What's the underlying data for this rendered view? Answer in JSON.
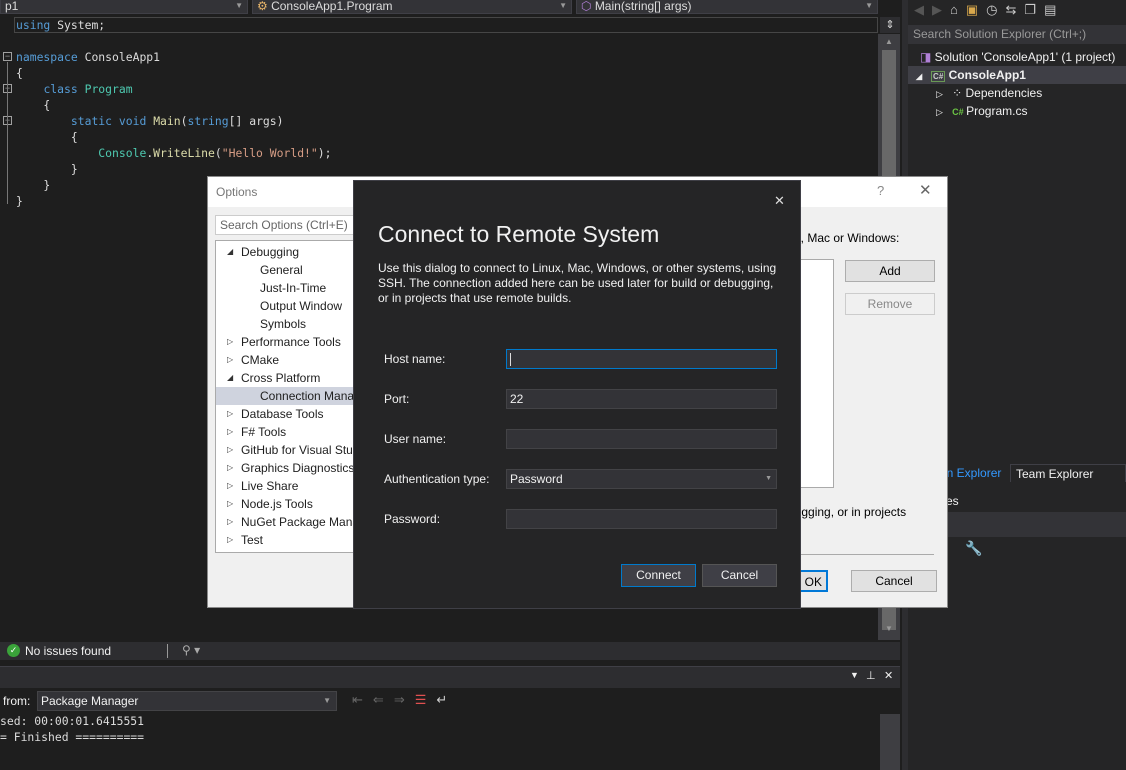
{
  "nav": {
    "project": "p1",
    "class": "ConsoleApp1.Program",
    "member": "Main(string[] args)"
  },
  "code": {
    "lines": [
      [
        {
          "t": "using",
          "c": "kw"
        },
        {
          "t": " System;"
        }
      ],
      [],
      [
        {
          "t": "namespace",
          "c": "kw"
        },
        {
          "t": " ConsoleApp1"
        }
      ],
      [
        {
          "t": "{"
        }
      ],
      [
        {
          "t": "    "
        },
        {
          "t": "class",
          "c": "kw"
        },
        {
          "t": " "
        },
        {
          "t": "Program",
          "c": "ty"
        }
      ],
      [
        {
          "t": "    {"
        }
      ],
      [
        {
          "t": "        "
        },
        {
          "t": "static",
          "c": "kw"
        },
        {
          "t": " "
        },
        {
          "t": "void",
          "c": "kw"
        },
        {
          "t": " "
        },
        {
          "t": "Main",
          "c": "fn"
        },
        {
          "t": "("
        },
        {
          "t": "string",
          "c": "kw"
        },
        {
          "t": "[] args)"
        }
      ],
      [
        {
          "t": "        {"
        }
      ],
      [
        {
          "t": "            "
        },
        {
          "t": "Console",
          "c": "ty"
        },
        {
          "t": "."
        },
        {
          "t": "WriteLine",
          "c": "fn"
        },
        {
          "t": "("
        },
        {
          "t": "\"Hello World!\"",
          "c": "st"
        },
        {
          "t": ");"
        }
      ],
      [
        {
          "t": "        }"
        }
      ],
      [
        {
          "t": "    }"
        }
      ],
      [
        {
          "t": "}"
        }
      ]
    ]
  },
  "solution_explorer": {
    "search_placeholder": "Search Solution Explorer (Ctrl+;)",
    "items": [
      {
        "label": "Solution 'ConsoleApp1' (1 project)",
        "icon": "solution-icon"
      },
      {
        "label": "ConsoleApp1",
        "icon": "csharp-project-icon"
      },
      {
        "label": "Dependencies",
        "icon": "dependencies-icon"
      },
      {
        "label": "Program.cs",
        "icon": "csharp-file-icon"
      }
    ],
    "tabs": [
      "on Explorer",
      "Team Explorer"
    ],
    "properties_title": "ties"
  },
  "status": {
    "issues": "No issues found"
  },
  "output": {
    "from_label": "from:",
    "source": "Package Manager",
    "lines": [
      "sed: 00:00:01.6415551",
      "= Finished =========="
    ]
  },
  "options": {
    "title": "Options",
    "help": "?",
    "search_placeholder": "Search Options (Ctrl+E)",
    "tree": [
      {
        "label": "Debugging",
        "level": 0,
        "expanded": true
      },
      {
        "label": "General",
        "level": 1
      },
      {
        "label": "Just-In-Time",
        "level": 1
      },
      {
        "label": "Output Window",
        "level": 1
      },
      {
        "label": "Symbols",
        "level": 1
      },
      {
        "label": "Performance Tools",
        "level": 0,
        "expanded": false
      },
      {
        "label": "CMake",
        "level": 0,
        "expanded": false
      },
      {
        "label": "Cross Platform",
        "level": 0,
        "expanded": true
      },
      {
        "label": "Connection Manager",
        "level": 1,
        "selected": true
      },
      {
        "label": "Database Tools",
        "level": 0,
        "expanded": false
      },
      {
        "label": "F# Tools",
        "level": 0,
        "expanded": false
      },
      {
        "label": "GitHub for Visual Studio",
        "level": 0,
        "expanded": false
      },
      {
        "label": "Graphics Diagnostics",
        "level": 0,
        "expanded": false
      },
      {
        "label": "Live Share",
        "level": 0,
        "expanded": false
      },
      {
        "label": "Node.js Tools",
        "level": 0,
        "expanded": false
      },
      {
        "label": "NuGet Package Manager",
        "level": 0,
        "expanded": false
      },
      {
        "label": "Test",
        "level": 0,
        "expanded": false
      }
    ],
    "heading": "ux, Mac or Windows:",
    "add": "Add",
    "remove": "Remove",
    "footer_text": "bugging, or in projects",
    "ok": "OK",
    "cancel": "Cancel"
  },
  "connect": {
    "title": "Connect to Remote System",
    "description": "Use this dialog to connect to Linux, Mac, Windows, or other systems, using SSH. The connection added here can be used later for build or debugging, or in projects that use remote builds.",
    "fields": {
      "host_label": "Host name:",
      "host_value": "",
      "port_label": "Port:",
      "port_value": "22",
      "user_label": "User name:",
      "user_value": "",
      "auth_label": "Authentication type:",
      "auth_value": "Password",
      "password_label": "Password:",
      "password_value": ""
    },
    "connect": "Connect",
    "cancel": "Cancel"
  },
  "colors": {
    "accent": "#007acc",
    "editor_bg": "#1e1e1e",
    "dialog_bg": "#252526"
  }
}
